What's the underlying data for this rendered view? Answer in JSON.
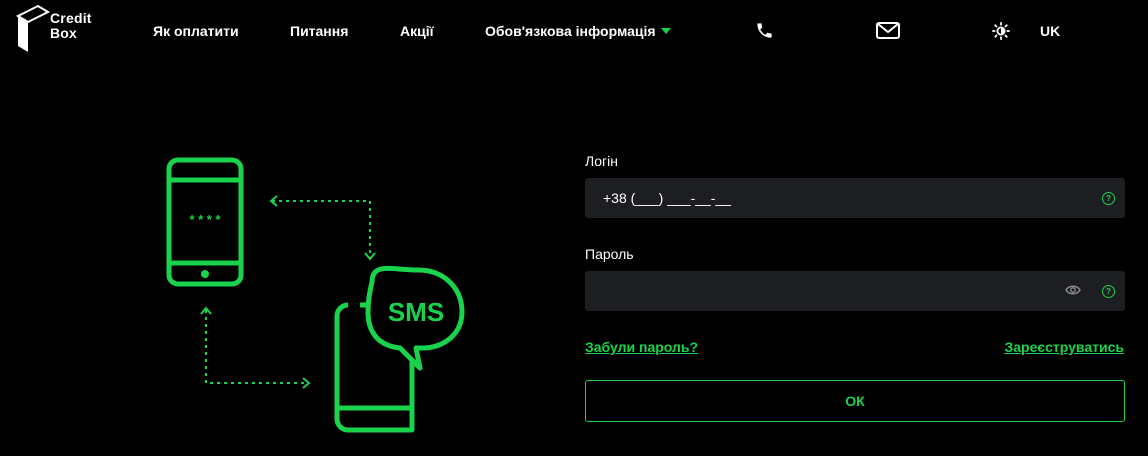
{
  "brand": {
    "line1": "Credit",
    "line2": "Box"
  },
  "nav": {
    "items": [
      {
        "label": "Як оплатити"
      },
      {
        "label": "Питання"
      },
      {
        "label": "Акції"
      },
      {
        "label": "Обов'язкова інформація"
      }
    ]
  },
  "header_icons": [
    "phone-icon",
    "mail-icon",
    "theme-toggle-icon"
  ],
  "language": "UK",
  "illustration": {
    "pin_mask": "* * * *",
    "sms_label": "SMS"
  },
  "form": {
    "login_label": "Логін",
    "login_value": "+38 (___) ___-__-__",
    "password_label": "Пароль",
    "password_value": "",
    "help_glyph": "?",
    "forgot_link": "Забули пароль?",
    "register_link": "Зареєструватись",
    "submit_label": "ОК"
  },
  "colors": {
    "accent": "#19d34c",
    "background": "#000000",
    "field_bg": "#1d1e21",
    "text": "#ffffff"
  }
}
